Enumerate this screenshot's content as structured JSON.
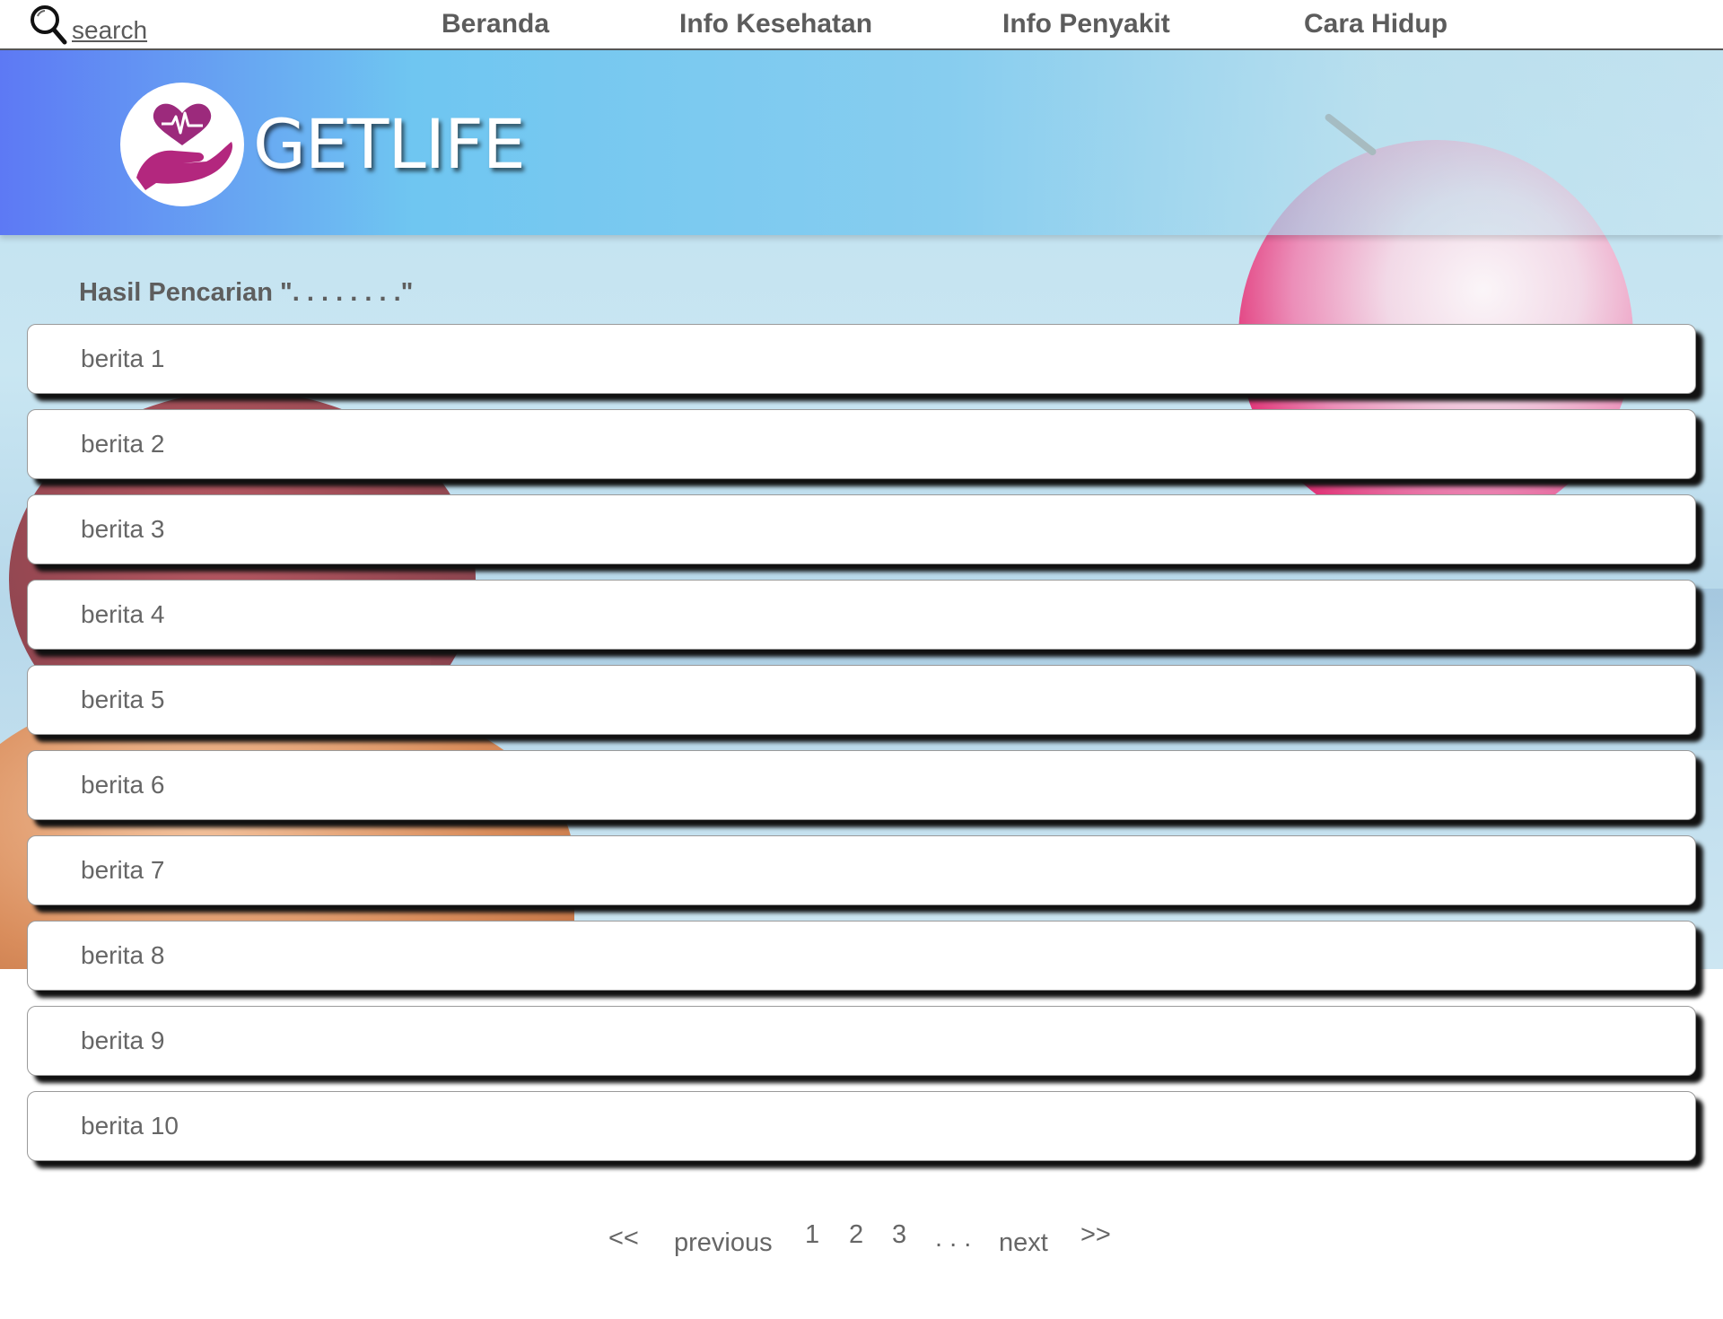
{
  "nav": {
    "search_label": "search",
    "items": [
      {
        "label": "Beranda"
      },
      {
        "label": "Info Kesehatan"
      },
      {
        "label": "Info Penyakit"
      },
      {
        "label": "Cara Hidup"
      }
    ]
  },
  "banner": {
    "brand": "GETLIFE"
  },
  "results": {
    "title": "Hasil Pencarian \". . . . . . . .\"",
    "items": [
      {
        "label": "berita 1"
      },
      {
        "label": "berita 2"
      },
      {
        "label": "berita 3"
      },
      {
        "label": "berita 4"
      },
      {
        "label": "berita 5"
      },
      {
        "label": "berita 6"
      },
      {
        "label": "berita 7"
      },
      {
        "label": "berita 8"
      },
      {
        "label": "berita 9"
      },
      {
        "label": "berita 10"
      }
    ]
  },
  "pagination": {
    "first": "<<",
    "previous": "previous",
    "pages": [
      "1",
      "2",
      "3"
    ],
    "ellipsis": ". . .",
    "next": "next",
    "last": ">>"
  },
  "colors": {
    "nav_text": "#5c5c5c",
    "banner_left": "#5d79f4",
    "banner_mid": "#6fc6f1",
    "logo_purple": "#a3247f",
    "card_text": "#666666"
  }
}
